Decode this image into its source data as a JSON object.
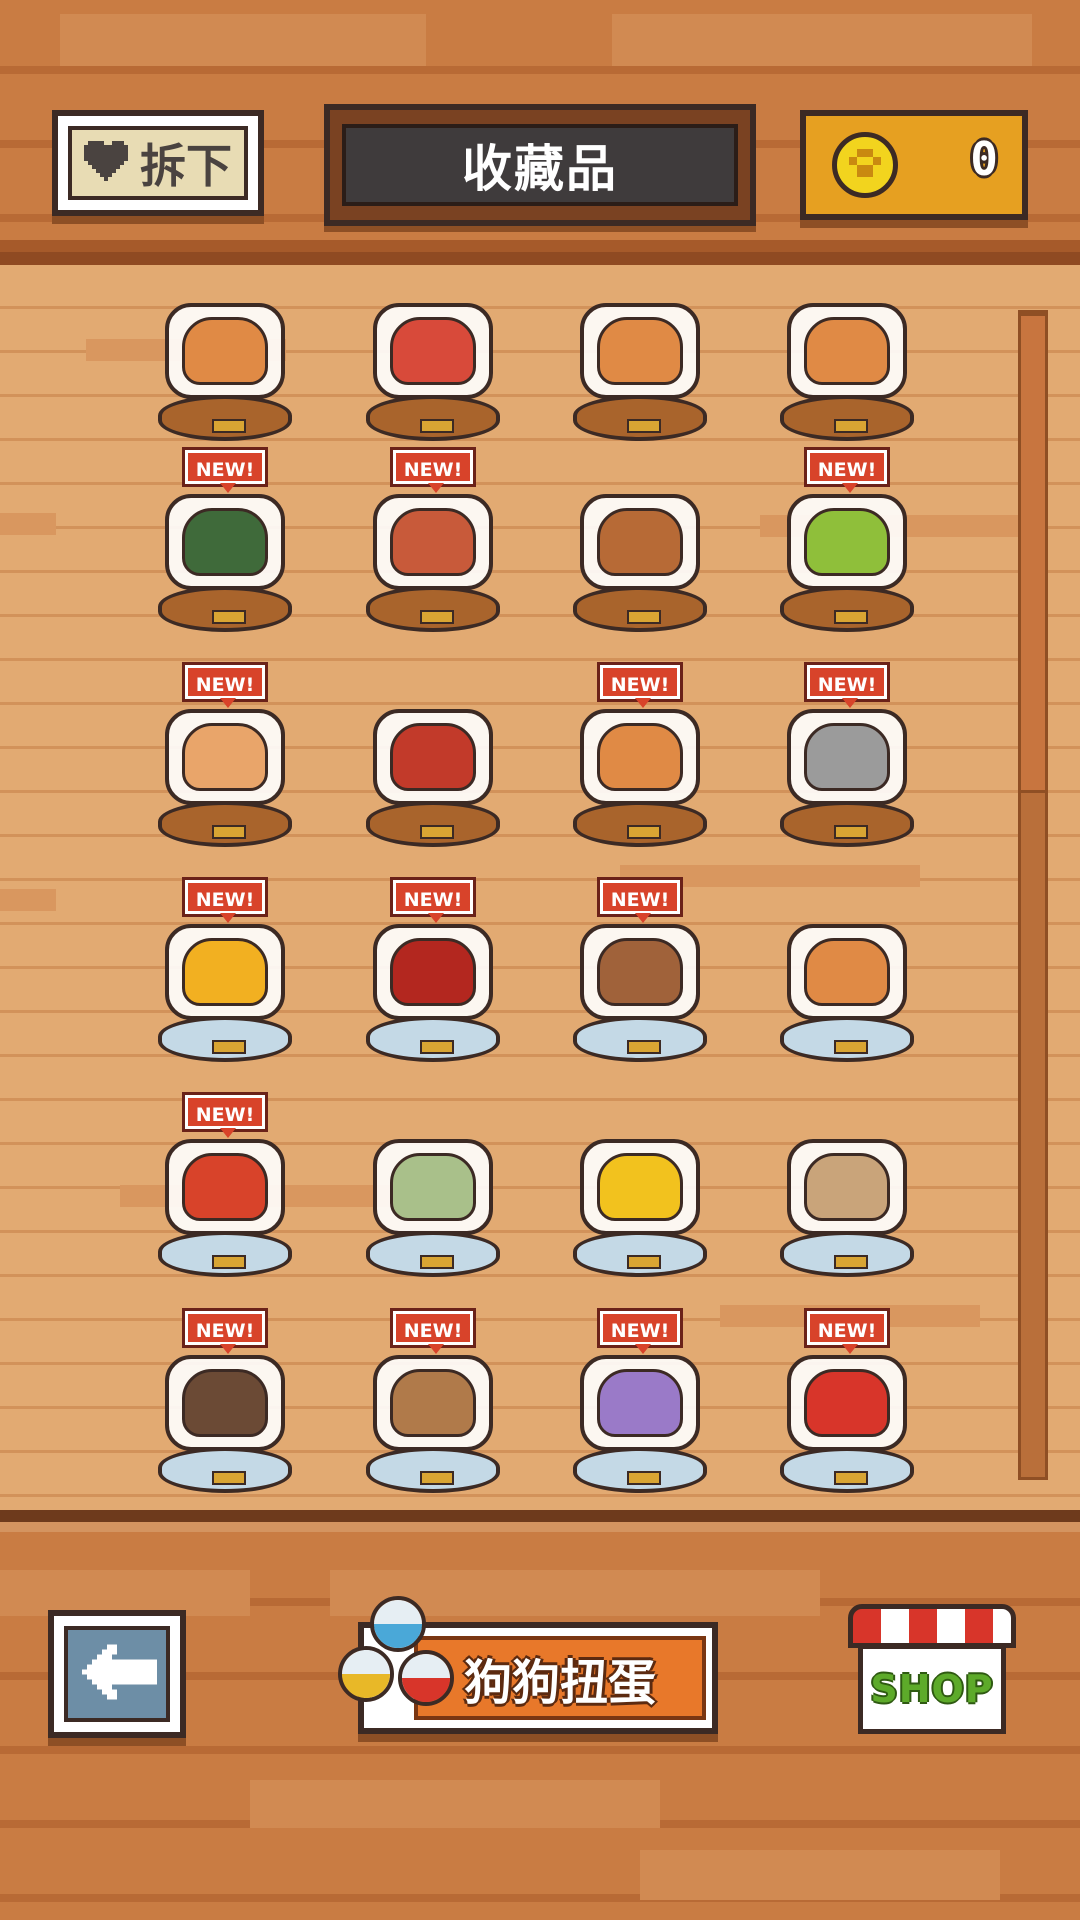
{
  "header": {
    "unequip_label": "拆下",
    "title": "收藏品",
    "coins": "0"
  },
  "icons": {
    "unequip": "heart-icon",
    "coin": "paw-coin-icon",
    "back": "arrow-left-icon",
    "gacha": "capsule-icon",
    "shop": "shop-awning-icon"
  },
  "badges": {
    "new": "NEW!"
  },
  "collection": {
    "scroll_fraction": 0.35,
    "items": [
      {
        "new": false,
        "base": "wood",
        "color": "#e08a45"
      },
      {
        "new": false,
        "base": "wood",
        "color": "#d84a3a"
      },
      {
        "new": false,
        "base": "wood",
        "color": "#e08a45"
      },
      {
        "new": false,
        "base": "wood",
        "color": "#e08a45"
      },
      {
        "new": true,
        "base": "wood",
        "color": "#3f6a3a"
      },
      {
        "new": true,
        "base": "wood",
        "color": "#c85a3a"
      },
      {
        "new": false,
        "base": "wood",
        "color": "#b76a36"
      },
      {
        "new": true,
        "base": "wood",
        "color": "#8fbf3a"
      },
      {
        "new": true,
        "base": "wood",
        "color": "#e9a56a"
      },
      {
        "new": false,
        "base": "wood",
        "color": "#c23a2a"
      },
      {
        "new": true,
        "base": "wood",
        "color": "#e08a45"
      },
      {
        "new": true,
        "base": "wood",
        "color": "#9b9b9b"
      },
      {
        "new": true,
        "base": "glass",
        "color": "#f2b021"
      },
      {
        "new": true,
        "base": "glass",
        "color": "#b3271f"
      },
      {
        "new": true,
        "base": "glass",
        "color": "#a0623a"
      },
      {
        "new": false,
        "base": "glass",
        "color": "#e08a45"
      },
      {
        "new": true,
        "base": "glass",
        "color": "#d8432a"
      },
      {
        "new": false,
        "base": "glass",
        "color": "#a9c08a"
      },
      {
        "new": false,
        "base": "glass",
        "color": "#f2c21e"
      },
      {
        "new": false,
        "base": "glass",
        "color": "#c9a47a"
      },
      {
        "new": true,
        "base": "glass",
        "color": "#6b4a35"
      },
      {
        "new": true,
        "base": "glass",
        "color": "#b07a4a"
      },
      {
        "new": true,
        "base": "glass",
        "color": "#9a7ac8"
      },
      {
        "new": true,
        "base": "glass",
        "color": "#d8352a"
      }
    ]
  },
  "footer": {
    "gacha_label": "狗狗扭蛋",
    "shop_label": "SHOP"
  },
  "colors": {
    "accent": "#e8782a",
    "new_badge": "#d8432a",
    "coin": "#e6a021"
  }
}
